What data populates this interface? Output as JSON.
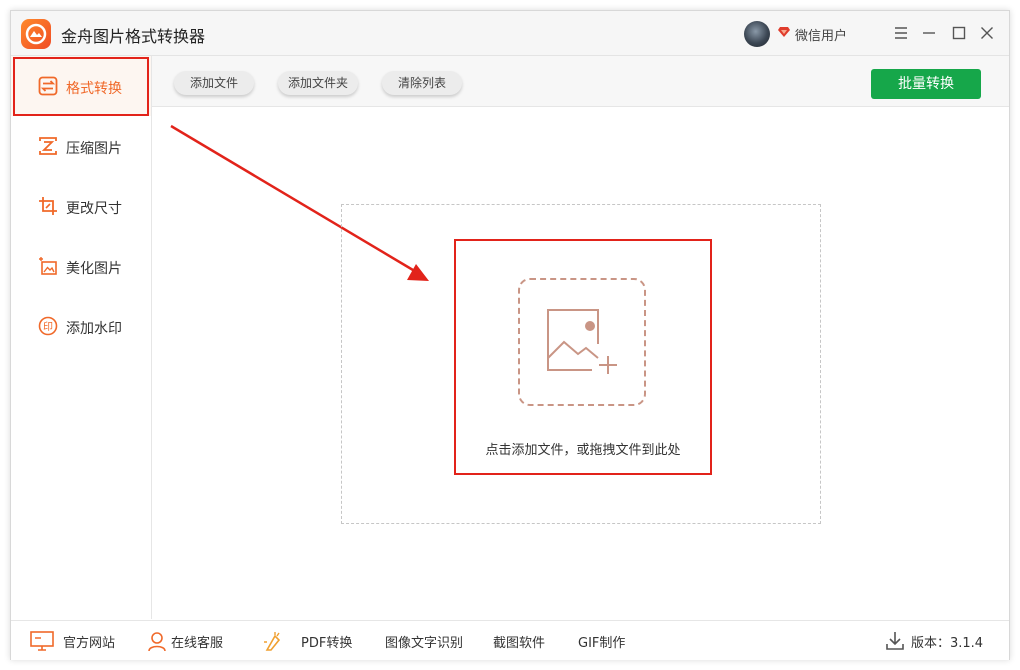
{
  "app": {
    "title": "金舟图片格式转换器"
  },
  "user": {
    "name": "微信用户"
  },
  "sidebar": {
    "items": [
      {
        "label": "格式转换",
        "icon": "swap-icon"
      },
      {
        "label": "压缩图片",
        "icon": "compress-icon"
      },
      {
        "label": "更改尺寸",
        "icon": "crop-icon"
      },
      {
        "label": "美化图片",
        "icon": "beautify-icon"
      },
      {
        "label": "添加水印",
        "icon": "watermark-icon"
      }
    ]
  },
  "toolbar": {
    "add_file": "添加文件",
    "add_folder": "添加文件夹",
    "clear_list": "清除列表",
    "batch_convert": "批量转换"
  },
  "dropzone": {
    "hint": "点击添加文件，或拖拽文件到此处"
  },
  "footer": {
    "website": "官方网站",
    "support": "在线客服",
    "pdf": "PDF转换",
    "ocr": "图像文字识别",
    "screenshot": "截图软件",
    "gif": "GIF制作",
    "version": "版本：3.1.4"
  },
  "colors": {
    "accent": "#f0692a",
    "highlight": "#e2231a",
    "primary": "#16a74a"
  }
}
